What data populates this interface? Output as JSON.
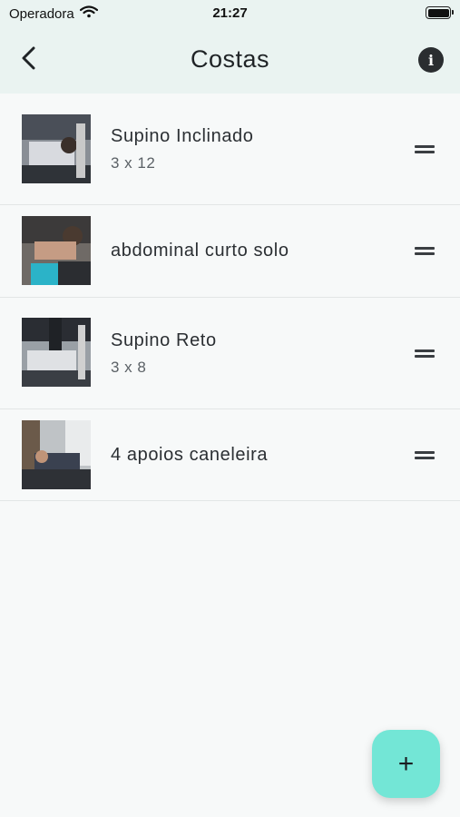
{
  "status_bar": {
    "carrier": "Operadora",
    "time": "21:27",
    "wifi_icon": "wifi-icon",
    "battery_icon": "battery-icon"
  },
  "nav": {
    "title": "Costas",
    "back_icon": "chevron-left-icon",
    "info_icon": "info-icon",
    "info_glyph": "i"
  },
  "exercises": [
    {
      "name": "Supino Inclinado",
      "detail": "3 x 12"
    },
    {
      "name": "abdominal curto solo",
      "detail": ""
    },
    {
      "name": "Supino Reto",
      "detail": "3 x 8"
    },
    {
      "name": "4 apoios caneleira",
      "detail": ""
    }
  ],
  "fab": {
    "label": "+",
    "icon": "plus-icon"
  },
  "colors": {
    "header_bg": "#eaf3f1",
    "page_bg": "#f7f9f9",
    "fab_bg": "#73e6d6",
    "divider": "#e2e6e6"
  }
}
